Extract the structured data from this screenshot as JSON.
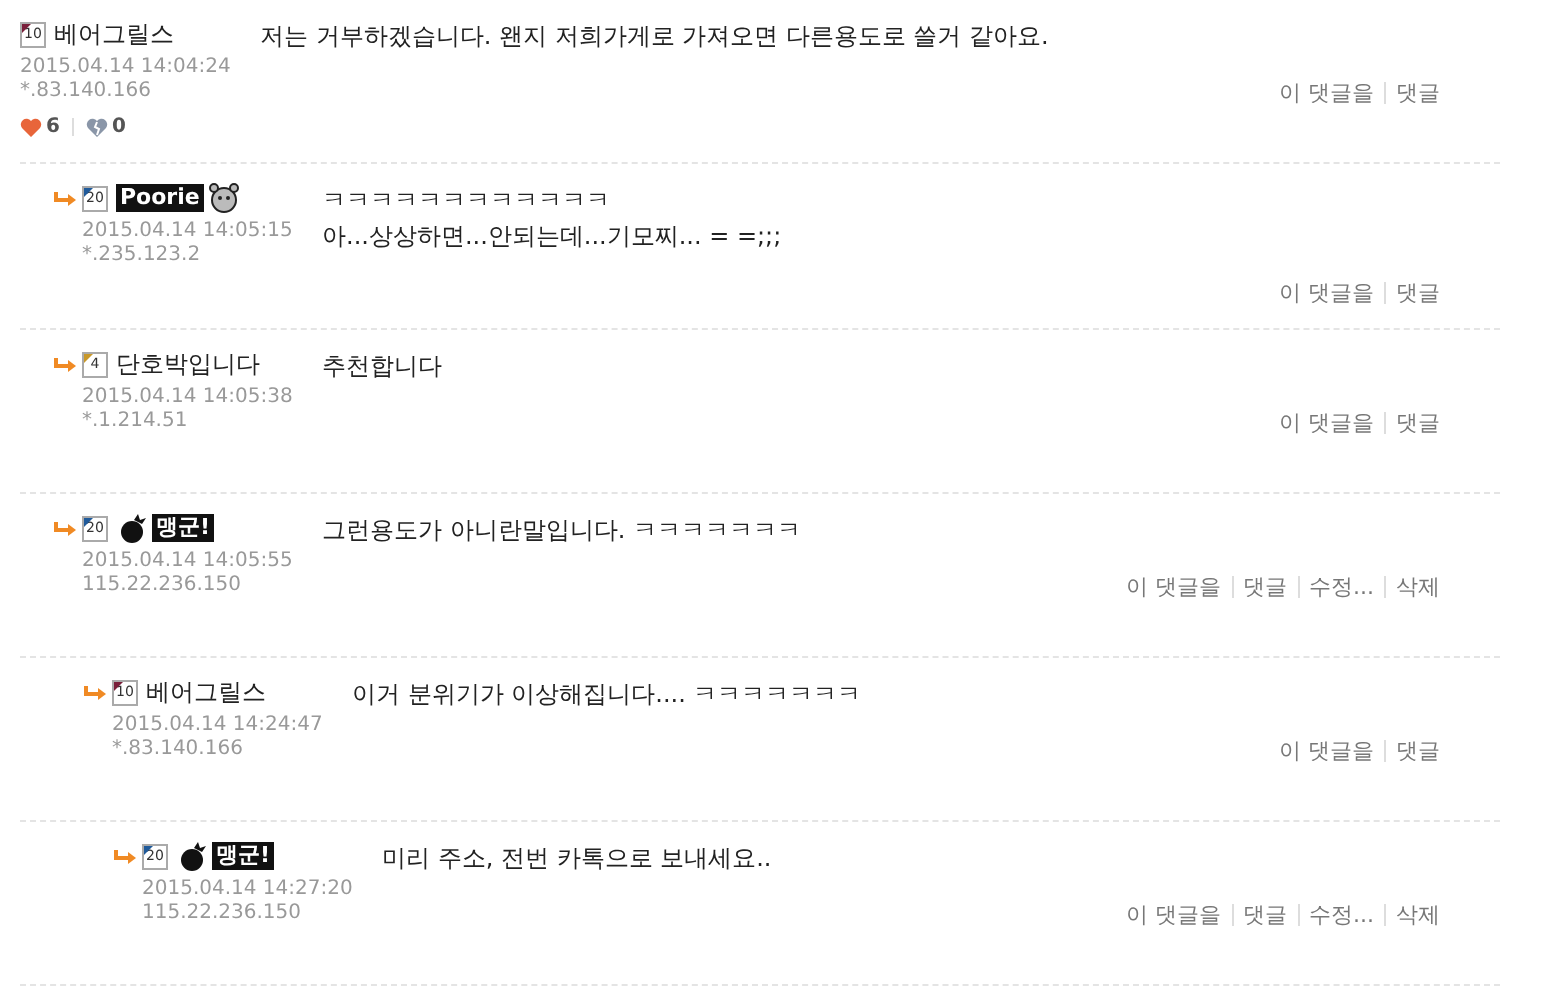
{
  "comments": [
    {
      "badge": "10",
      "color": "#7a1f3a",
      "nickname": {
        "kind": "text",
        "text": "베어그릴스"
      },
      "date": "2015.04.14 14:04:24",
      "ip": "*.83.140.166",
      "lines": [
        "저는 거부하겠습니다. 왠지 저희가게로 가져오면 다른용도로 쓸거 같아요."
      ],
      "likes": "6",
      "dislikes": "0",
      "actions": [
        "이 댓글을",
        "댓글"
      ],
      "children": [
        {
          "badge": "20",
          "color": "#1f5a9a",
          "nickname": {
            "kind": "image",
            "text": "Poorie"
          },
          "date": "2015.04.14 14:05:15",
          "ip": "*.235.123.2",
          "lines": [
            "ㅋㅋㅋㅋㅋㅋㅋㅋㅋㅋㅋㅋ",
            "아...상상하면...안되는데...기모찌... = =;;;"
          ],
          "actions": [
            "이 댓글을",
            "댓글"
          ]
        },
        {
          "badge": "4",
          "color": "#c8982a",
          "nickname": {
            "kind": "text",
            "text": "단호박입니다"
          },
          "date": "2015.04.14 14:05:38",
          "ip": "*.1.214.51",
          "lines": [
            "추천합니다"
          ],
          "actions": [
            "이 댓글을",
            "댓글"
          ]
        },
        {
          "badge": "20",
          "color": "#1f5a9a",
          "nickname": {
            "kind": "iconimage",
            "text": "맹군!"
          },
          "date": "2015.04.14 14:05:55",
          "ip": "115.22.236.150",
          "lines": [
            "그런용도가 아니란말입니다. ㅋㅋㅋㅋㅋㅋㅋ"
          ],
          "actions": [
            "이 댓글을",
            "댓글",
            "수정...",
            "삭제"
          ],
          "children": [
            {
              "badge": "10",
              "color": "#7a1f3a",
              "nickname": {
                "kind": "text",
                "text": "베어그릴스"
              },
              "date": "2015.04.14 14:24:47",
              "ip": "*.83.140.166",
              "lines": [
                "이거 분위기가 이상해집니다.... ㅋㅋㅋㅋㅋㅋㅋ"
              ],
              "actions": [
                "이 댓글을",
                "댓글"
              ],
              "children": [
                {
                  "badge": "20",
                  "color": "#1f5a9a",
                  "nickname": {
                    "kind": "iconimage",
                    "text": "맹군!"
                  },
                  "date": "2015.04.14 14:27:20",
                  "ip": "115.22.236.150",
                  "lines": [
                    "미리 주소, 전번 카톡으로 보내세요.."
                  ],
                  "actions": [
                    "이 댓글을",
                    "댓글",
                    "수정...",
                    "삭제"
                  ]
                }
              ]
            }
          ]
        }
      ]
    }
  ]
}
